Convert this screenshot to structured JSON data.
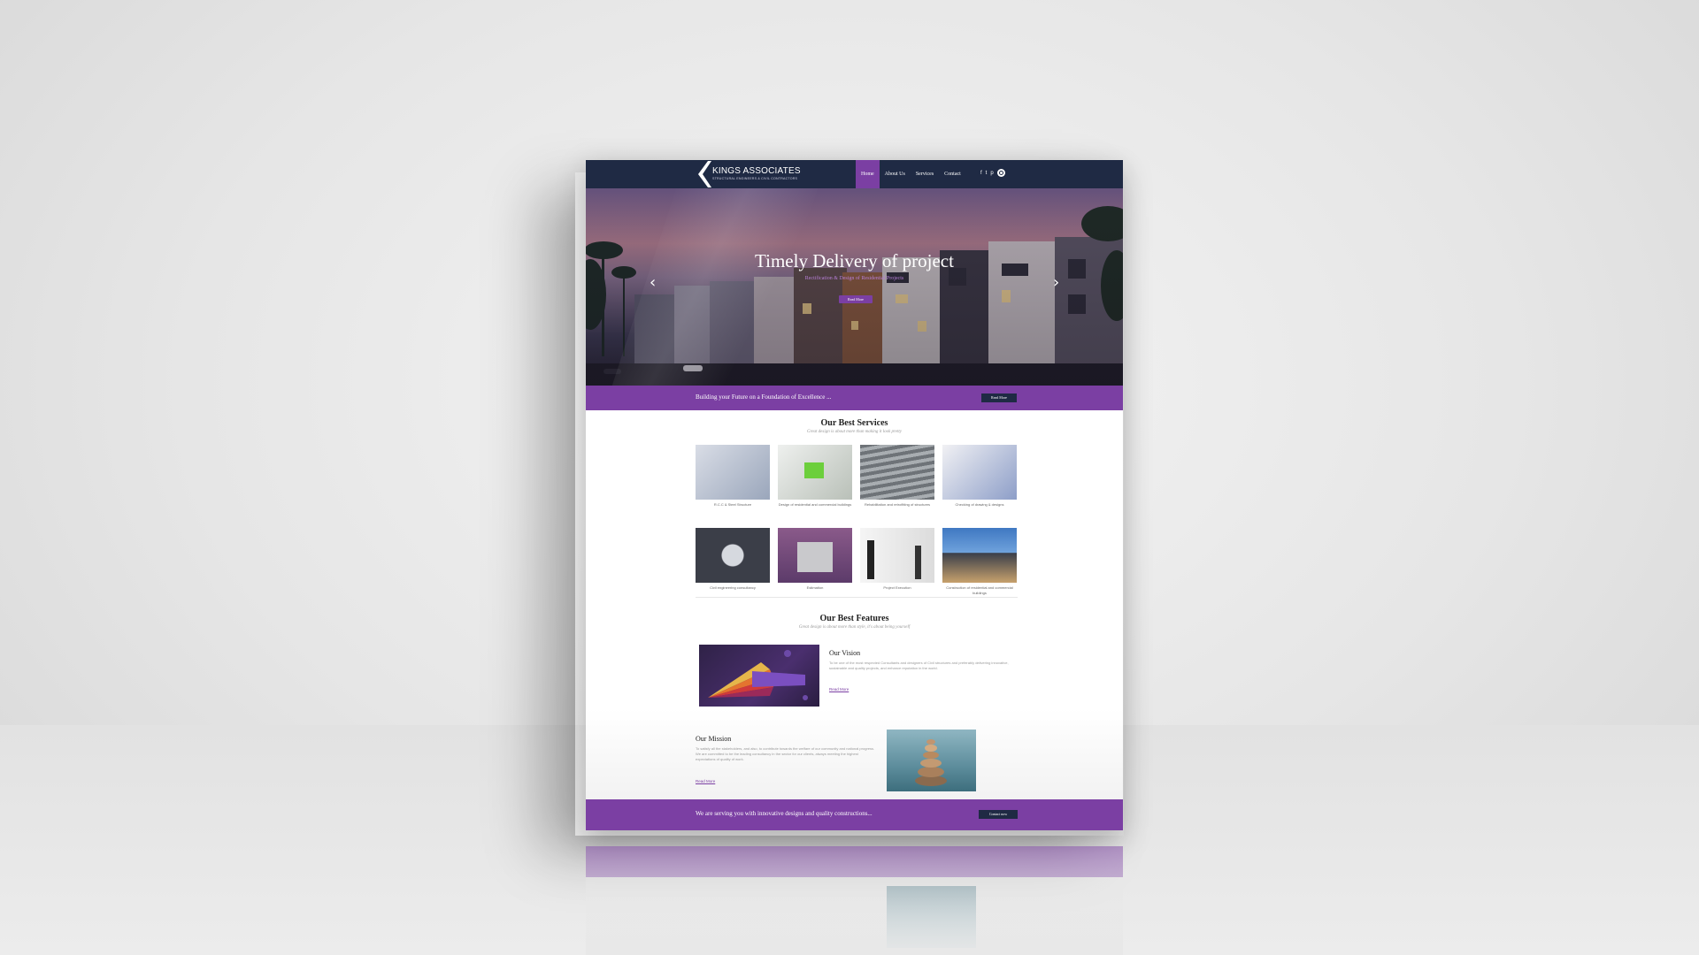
{
  "brand": {
    "name": "KINGS ASSOCIATES",
    "tagline": "STRUCTURAL ENGINEERS & CIVIL CONTRACTORS",
    "primary_color": "#7b3fa3",
    "nav_color": "#1f2a44"
  },
  "nav": {
    "items": [
      {
        "label": "Home",
        "active": true
      },
      {
        "label": "About Us",
        "active": false
      },
      {
        "label": "Services",
        "active": false
      },
      {
        "label": "Contact",
        "active": false
      }
    ],
    "social": [
      "f",
      "t",
      "p"
    ],
    "icons": [
      "facebook-icon",
      "twitter-icon",
      "pinterest-icon",
      "search-icon"
    ]
  },
  "hero": {
    "title": "Timely Delivery of project",
    "subtitle": "Rectification & Design of Residential Projects",
    "button": "Read More",
    "prev_arrow": "‹",
    "next_arrow": "›"
  },
  "band": {
    "text": "Building your Future on a Foundation of Excellence ...",
    "button": "Read More"
  },
  "services": {
    "title": "Our Best Services",
    "subtitle": "Great design is about more than making it look pretty",
    "items": [
      {
        "caption": "R.C.C & Steel Structure"
      },
      {
        "caption": "Design of residential and commercial buildings"
      },
      {
        "caption": "Rehabilitation and retrofitting of structures"
      },
      {
        "caption": "Checking of drawing & designs"
      },
      {
        "caption": "Civil engineering consultancy"
      },
      {
        "caption": "Estimation"
      },
      {
        "caption": "Project Execution"
      },
      {
        "caption": "Construction of residential and commercial buildings"
      }
    ]
  },
  "features": {
    "title": "Our Best Features",
    "subtitle": "Great design is about more than style, it's about being yourself"
  },
  "vision": {
    "title": "Our Vision",
    "body": "To be one of the most respected Consultants and designers of Civil structures and preferably delivering innovative, sustainable and quality projects, and enhance reputation in the world.",
    "link": "Read More"
  },
  "mission": {
    "title": "Our Mission",
    "body": "To satisfy all the stakeholders, and also, to contribute towards the welfare of our community and national progress. We are committed to be the leading consultancy in the sector for our clients, always meeting the highest expectations of quality of work.",
    "link": "Read More"
  },
  "footer": {
    "text": "We are serving you with innovative designs and quality constructions...",
    "button": "Contact now"
  }
}
